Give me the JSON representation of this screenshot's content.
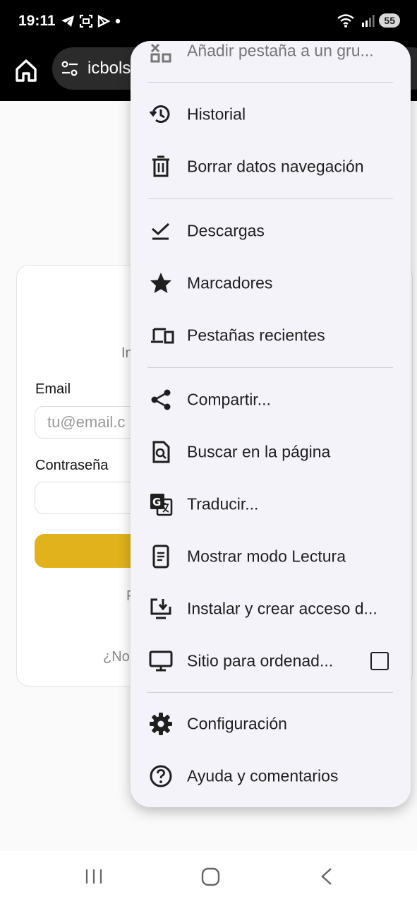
{
  "status_bar": {
    "time": "19:11",
    "battery": "55"
  },
  "toolbar": {
    "url_text": "icbols"
  },
  "page": {
    "card_subtitle": "In",
    "email_label": "Email",
    "email_placeholder": "tu@email.c",
    "password_label": "Contraseña",
    "link_forgot": "F",
    "link_register": "¿No"
  },
  "menu": {
    "items": [
      {
        "label": "Añadir pestaña a un gru...",
        "icon": "tab-group-icon"
      },
      {
        "label": "Historial",
        "icon": "history-icon"
      },
      {
        "label": "Borrar datos navegación",
        "icon": "trash-icon"
      },
      {
        "label": "Descargas",
        "icon": "download-done-icon"
      },
      {
        "label": "Marcadores",
        "icon": "star-icon"
      },
      {
        "label": "Pestañas recientes",
        "icon": "devices-icon"
      },
      {
        "label": "Compartir...",
        "icon": "share-icon"
      },
      {
        "label": "Buscar en la página",
        "icon": "find-in-page-icon"
      },
      {
        "label": "Traducir...",
        "icon": "translate-icon"
      },
      {
        "label": "Mostrar modo Lectura",
        "icon": "reader-mode-icon"
      },
      {
        "label": "Instalar y crear acceso d...",
        "icon": "install-icon"
      },
      {
        "label": "Sitio para ordenad...",
        "icon": "desktop-icon"
      },
      {
        "label": "Configuración",
        "icon": "gear-icon"
      },
      {
        "label": "Ayuda y comentarios",
        "icon": "help-icon"
      }
    ]
  }
}
